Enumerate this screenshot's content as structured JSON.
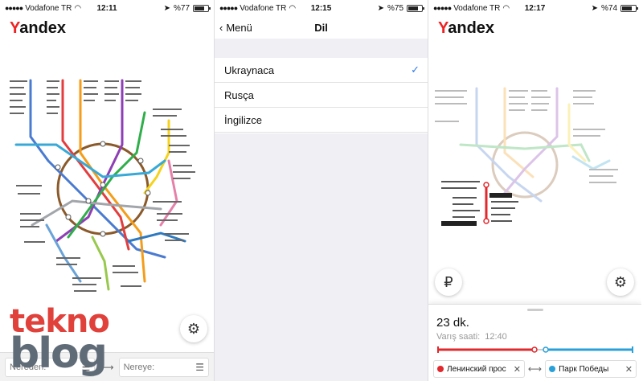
{
  "screen1": {
    "status": {
      "carrier": "Vodafone TR",
      "time": "12:11",
      "battery": "%77",
      "battery_level": 0.77
    },
    "logo": "Yandex",
    "from_placeholder": "Nereden:",
    "to_placeholder": "Nereye:"
  },
  "screen2": {
    "status": {
      "carrier": "Vodafone TR",
      "time": "12:15",
      "battery": "%75",
      "battery_level": 0.75
    },
    "back_label": "Menü",
    "title": "Dil",
    "languages": [
      {
        "label": "Ukraynaca",
        "selected": true
      },
      {
        "label": "Rusça",
        "selected": false
      },
      {
        "label": "İngilizce",
        "selected": false
      }
    ]
  },
  "screen3": {
    "status": {
      "carrier": "Vodafone TR",
      "time": "12:17",
      "battery": "%74",
      "battery_level": 0.74
    },
    "logo": "Yandex",
    "duration": "23 dk.",
    "arrival_label": "Varış saati:",
    "arrival_time": "12:40",
    "from_station": "Ленинский прос",
    "to_station": "Парк Победы",
    "from_color": "#e0282d",
    "to_color": "#2aa0d8",
    "ruble_symbol": "₽"
  },
  "watermark": {
    "line1": "tekno",
    "line2": "blog"
  }
}
